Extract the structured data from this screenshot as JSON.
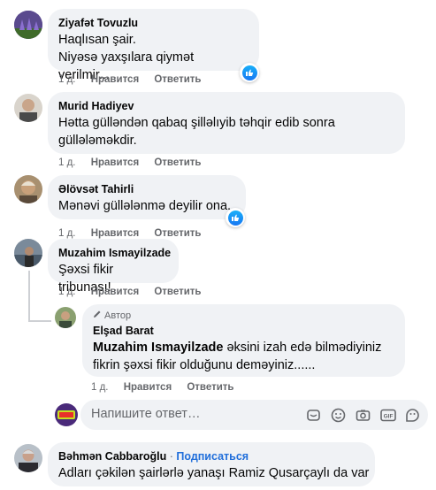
{
  "comments": [
    {
      "author": "Ziyafət Tovuzlu",
      "lines": [
        "Haqlısan şair.",
        "Niyəsə yaxşılara qiymət verilmir..."
      ],
      "time": "1 д.",
      "like": "Нравится",
      "reply": "Ответить"
    },
    {
      "author": "Murid Hadiyev",
      "lines": [
        "Hətta gülləndən qabaq şilləlıyib təhqir edib sonra",
        "güllələməkdir."
      ],
      "time": "1 д.",
      "like": "Нравится",
      "reply": "Ответить"
    },
    {
      "author": "Əlövsət Tahirli",
      "lines": [
        "Mənəvi güllələnmə deyilir ona."
      ],
      "time": "1 д.",
      "like": "Нравится",
      "reply": "Ответить"
    },
    {
      "author": "Muzahim Ismayilzade",
      "lines": [
        "Şəxsi fikir tribunası!"
      ],
      "time": "1 д.",
      "like": "Нравится",
      "reply": "Ответить"
    }
  ],
  "reply": {
    "tag": "Автор",
    "author": "Elşad Barat",
    "mention": "Muzahim Ismayilzade",
    "line1_rest": " əksini izah edə bilmədiyiniz",
    "line2": "fikrin şəxsi fikir olduğunu deməyiniz......",
    "time": "1 д.",
    "like": "Нравится",
    "reply": "Ответить"
  },
  "reply_box": {
    "placeholder": "Напишите ответ…",
    "icons": [
      "sticker-icon",
      "emoji-icon",
      "camera-icon",
      "gif-icon",
      "avatar-sticker-icon"
    ]
  },
  "last_comment": {
    "author": "Bəhmən Cabbaroğlu",
    "separator": " · ",
    "follow": "Подписаться",
    "text": "Adları çəkilən şairlərlə yanaşı Ramiz Qusarçaylı da var"
  },
  "colors": {
    "bubble": "#f0f2f5",
    "link": "#216fdb",
    "secondary": "#65676b",
    "like_blue": "#1877f2"
  }
}
